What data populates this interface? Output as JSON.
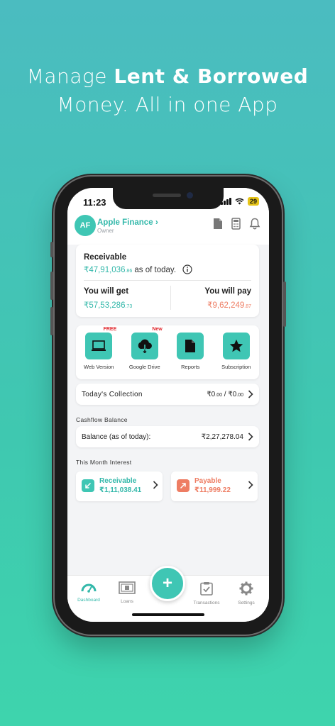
{
  "headline": {
    "line1_prefix": "Manage ",
    "line1_bold": "Lent & Borrowed",
    "line2": "Money. All in one App"
  },
  "status": {
    "time": "11:23",
    "battery": "29"
  },
  "org": {
    "initials": "AF",
    "name": "Apple Finance",
    "role": "Owner"
  },
  "receivable": {
    "label": "Receivable",
    "amount": "₹47,91,036",
    "amount_dec": ".86",
    "suffix": " as of today.",
    "get_label": "You will get",
    "get_amount": "₹57,53,286",
    "get_dec": ".73",
    "pay_label": "You will pay",
    "pay_amount": "₹9,62,249",
    "pay_dec": ".87"
  },
  "tiles": [
    {
      "name": "Web Version",
      "badge": "FREE",
      "icon": "laptop-icon"
    },
    {
      "name": "Google Drive",
      "badge": "New",
      "icon": "cloud-download-icon"
    },
    {
      "name": "Reports",
      "badge": "",
      "icon": "document-icon"
    },
    {
      "name": "Subscription",
      "badge": "",
      "icon": "star-icon"
    }
  ],
  "collection": {
    "label": "Today's Collection",
    "value1": "₹0",
    "dec1": ".00",
    "sep": " / ",
    "value2": "₹0",
    "dec2": ".00"
  },
  "cashflow": {
    "section": "Cashflow Balance",
    "label": "Balance (as of today):",
    "value": "₹2,27,278.04"
  },
  "interest": {
    "section": "This Month Interest",
    "receivable_label": "Receivable",
    "receivable_value": "₹1,11,038.41",
    "payable_label": "Payable",
    "payable_value": "₹11,999.22"
  },
  "tabs": [
    {
      "label": "Dashboard",
      "icon": "speedometer-icon"
    },
    {
      "label": "Loans",
      "icon": "cash-icon"
    },
    {
      "label": "Transactions",
      "icon": "clipboard-check-icon"
    },
    {
      "label": "Settings",
      "icon": "gear-icon"
    }
  ],
  "colors": {
    "accent": "#3fc6b4",
    "teal_text": "#33b8aa",
    "coral": "#ee7d63",
    "badge_red": "#e0262c"
  }
}
